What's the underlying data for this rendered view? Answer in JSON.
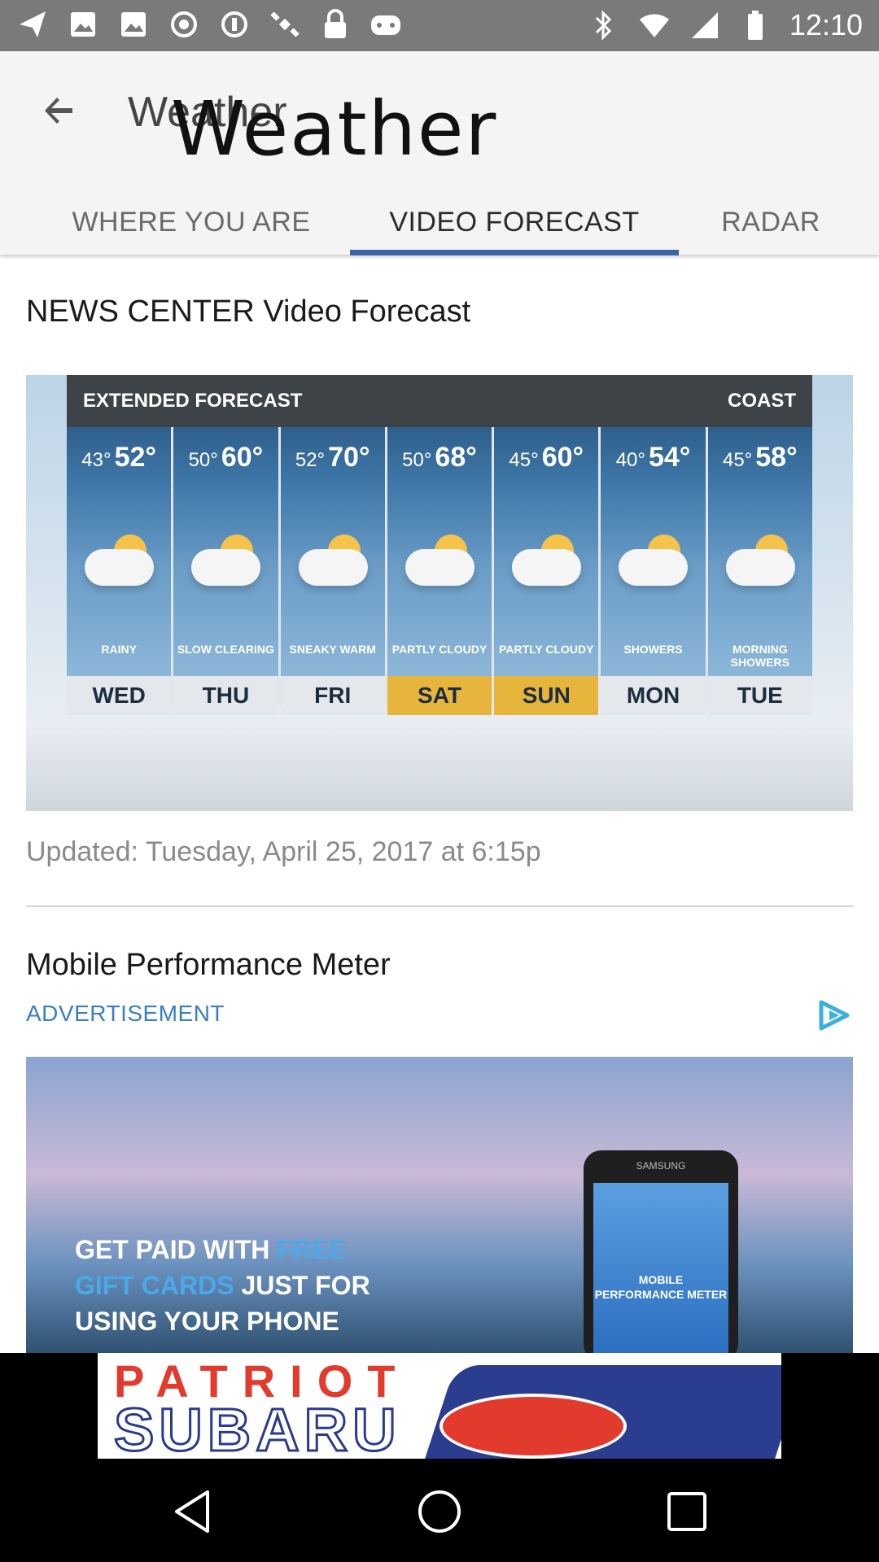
{
  "status_bar": {
    "time": "12:10",
    "left_icons": [
      "send-icon",
      "image-icon",
      "image-icon",
      "circle-icon",
      "circle-icon",
      "satellite-icon",
      "lock-icon",
      "game-icon"
    ],
    "right_icons": [
      "bluetooth-icon",
      "wifi-icon",
      "signal-icon",
      "battery-icon"
    ]
  },
  "app_bar": {
    "title": "Weather",
    "logo_text": "Weather",
    "tabs": [
      {
        "label": "WHERE YOU ARE",
        "active": false
      },
      {
        "label": "VIDEO FORECAST",
        "active": true
      },
      {
        "label": "RADAR",
        "active": false
      }
    ],
    "accent": "#3a66a8"
  },
  "video": {
    "section_title": "NEWS CENTER Video Forecast",
    "thumbnail": {
      "header_left": "EXTENDED FORECAST",
      "header_right": "COAST",
      "days": [
        {
          "day": "WED",
          "lo": "43°",
          "hi": "52°",
          "condition": "RAINY",
          "highlight": false
        },
        {
          "day": "THU",
          "lo": "50°",
          "hi": "60°",
          "condition": "SLOW CLEARING",
          "highlight": false
        },
        {
          "day": "FRI",
          "lo": "52°",
          "hi": "70°",
          "condition": "SNEAKY WARM",
          "highlight": false
        },
        {
          "day": "SAT",
          "lo": "50°",
          "hi": "68°",
          "condition": "PARTLY CLOUDY",
          "highlight": true
        },
        {
          "day": "SUN",
          "lo": "45°",
          "hi": "60°",
          "condition": "PARTLY CLOUDY",
          "highlight": true
        },
        {
          "day": "MON",
          "lo": "40°",
          "hi": "54°",
          "condition": "SHOWERS",
          "highlight": false
        },
        {
          "day": "TUE",
          "lo": "45°",
          "hi": "58°",
          "condition": "MORNING SHOWERS",
          "highlight": false
        }
      ]
    },
    "updated": "Updated: Tuesday, April 25, 2017 at 6:15p"
  },
  "ad": {
    "title": "Mobile Performance Meter",
    "label": "ADVERTISEMENT",
    "banner_line1_a": "GET PAID WITH ",
    "banner_line1_b": "FREE",
    "banner_line2_a": "GIFT CARDS",
    "banner_line2_b": " JUST FOR",
    "banner_line3": "USING YOUR PHONE",
    "phone_brand": "SAMSUNG",
    "phone_screen_text": "MOBILE PERFORMANCE METER"
  },
  "bottom_ad": {
    "line1": "PATRIOT",
    "line2": "SUBARU"
  },
  "nav": {
    "buttons": [
      "back-nav",
      "home-nav",
      "recents-nav"
    ]
  }
}
